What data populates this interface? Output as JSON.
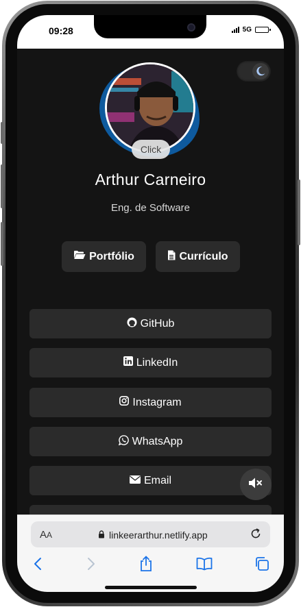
{
  "status_bar": {
    "time": "09:28",
    "network": "5G"
  },
  "profile": {
    "avatar_button_label": "Click",
    "name": "Arthur Carneiro",
    "role": "Eng. de Software"
  },
  "primary_buttons": {
    "portfolio": {
      "label": "Portfólio",
      "icon": "folder-open-icon"
    },
    "resume": {
      "label": "Currículo",
      "icon": "file-icon"
    }
  },
  "links": [
    {
      "label": "GitHub",
      "icon": "github-icon"
    },
    {
      "label": "LinkedIn",
      "icon": "linkedin-icon"
    },
    {
      "label": "Instagram",
      "icon": "instagram-icon"
    },
    {
      "label": "WhatsApp",
      "icon": "whatsapp-icon"
    },
    {
      "label": "Email",
      "icon": "envelope-icon"
    }
  ],
  "controls": {
    "theme_toggle_icon": "moon-icon",
    "mute_icon": "speaker-muted-icon"
  },
  "browser": {
    "text_size_label_big": "A",
    "text_size_label_small": "A",
    "url": "linkeerarthur.netlify.app"
  },
  "colors": {
    "page_background": "#141414",
    "button_background": "#2b2b2b",
    "avatar_blob": "#0e5a9e",
    "text": "#ffffff"
  }
}
